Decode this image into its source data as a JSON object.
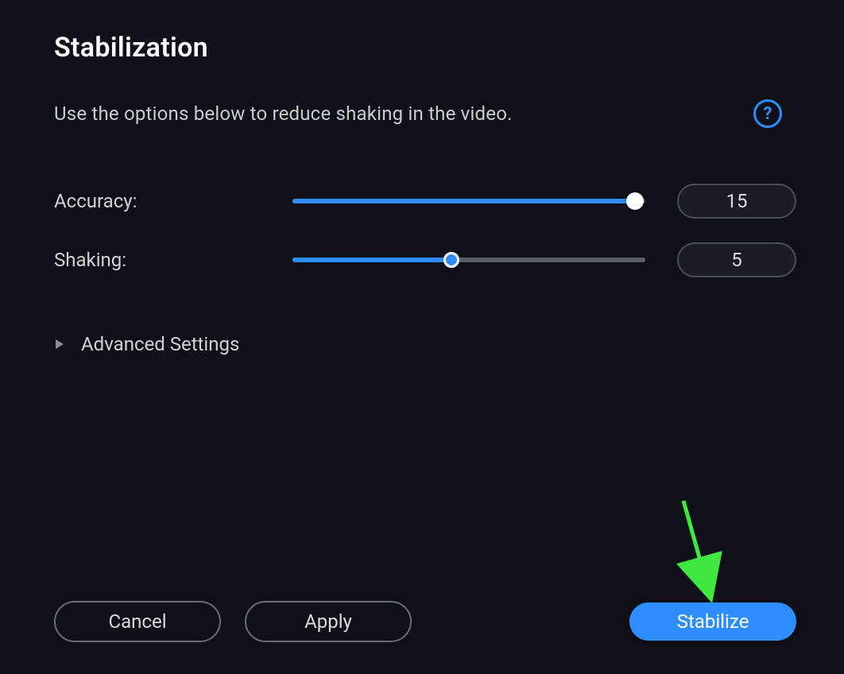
{
  "title": "Stabilization",
  "description": "Use the options below to reduce shaking in the video.",
  "sliders": {
    "accuracy": {
      "label": "Accuracy:",
      "value": "15",
      "percent": 97,
      "thumb_style": "white"
    },
    "shaking": {
      "label": "Shaking:",
      "value": "5",
      "percent": 45,
      "thumb_style": "blue"
    }
  },
  "advanced": {
    "label": "Advanced Settings"
  },
  "buttons": {
    "cancel": "Cancel",
    "apply": "Apply",
    "stabilize": "Stabilize"
  },
  "colors": {
    "accent": "#2e8eff",
    "annotation_arrow": "#3fe83f"
  }
}
